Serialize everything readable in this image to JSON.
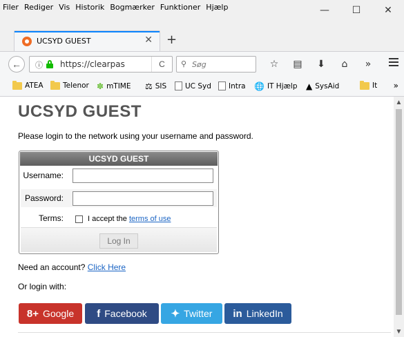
{
  "menubar": {
    "items": [
      "Filer",
      "Rediger",
      "Vis",
      "Historik",
      "Bogmærker",
      "Funktioner",
      "Hjælp"
    ],
    "controls": {
      "minimize": "—",
      "maximize": "☐",
      "close": "✕"
    }
  },
  "tab": {
    "title": "UCSYD GUEST",
    "close": "✕",
    "new_tab": "+"
  },
  "navbar": {
    "url": "https://clearpas",
    "search_placeholder": "Søg",
    "reload": "C",
    "more": "»"
  },
  "bookmarks": {
    "items": [
      "ATEA",
      "Telenor",
      "mTIME",
      "SIS",
      "UC Syd",
      "Intra",
      "IT Hjælp",
      "SysAid",
      "It"
    ],
    "more": "»"
  },
  "page": {
    "title": "UCSYD GUEST",
    "intro": "Please login to the network using your username and password.",
    "login_box": {
      "header": "UCSYD GUEST",
      "username_label": "Username:",
      "username_value": "",
      "password_label": "Password:",
      "password_value": "",
      "terms_label": "Terms:",
      "terms_prefix": "I accept the ",
      "terms_link": "terms of use",
      "login_button": "Log In"
    },
    "need_account": "Need an account?",
    "click_here": "Click Here",
    "or_login": "Or login with:",
    "social": {
      "google": "Google",
      "facebook": "Facebook",
      "twitter": "Twitter",
      "linkedin": "LinkedIn"
    }
  },
  "colors": {
    "google": "#c8332b",
    "facebook": "#2f4b84",
    "twitter": "#36a6e3",
    "linkedin": "#2b5b9b",
    "link": "#1a64c4",
    "tab_accent": "#0a84ff"
  }
}
